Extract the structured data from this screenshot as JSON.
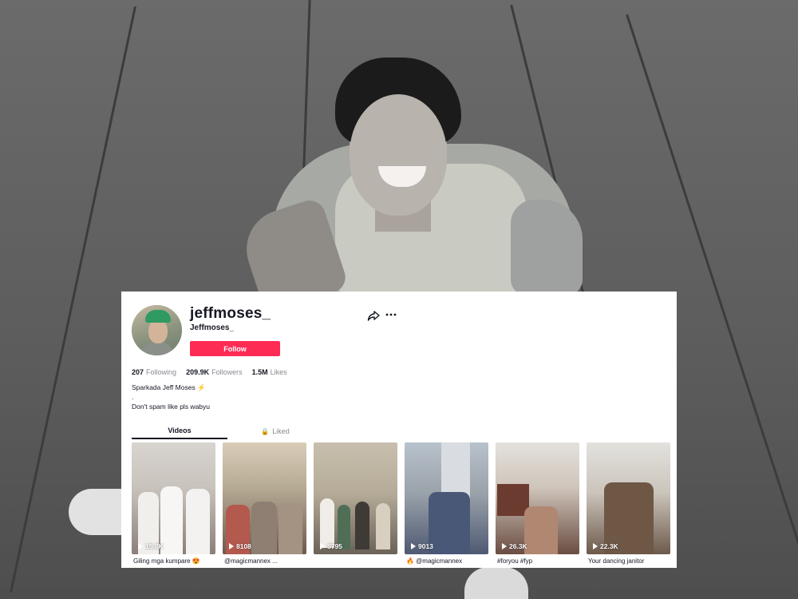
{
  "profile": {
    "username": "jeffmoses_",
    "nickname": "Jeffmoses_",
    "follow_label": "Follow",
    "stats": [
      {
        "value": "207",
        "label": "Following"
      },
      {
        "value": "209.9K",
        "label": "Followers"
      },
      {
        "value": "1.5M",
        "label": "Likes"
      }
    ],
    "bio_line1": "Sparkada Jeff Moses",
    "bio_line2": ".",
    "bio_line3": "Don't spam like pls wabyu"
  },
  "tabs": {
    "videos": "Videos",
    "liked": "Liked"
  },
  "videos": [
    {
      "views": "15.8K",
      "caption": "Giling mga kumpare 😍"
    },
    {
      "views": "8108",
      "caption": "@magicmannex ..."
    },
    {
      "views": "5795",
      "caption": ""
    },
    {
      "views": "9013",
      "caption": "🔥 @magicmannex"
    },
    {
      "views": "26.3K",
      "caption": "#foryou #fyp"
    },
    {
      "views": "22.3K",
      "caption": "Your dancing janitor"
    }
  ],
  "colors": {
    "follow_button": "#fe2c55",
    "text_primary": "#161823",
    "text_secondary": "#888a90"
  }
}
